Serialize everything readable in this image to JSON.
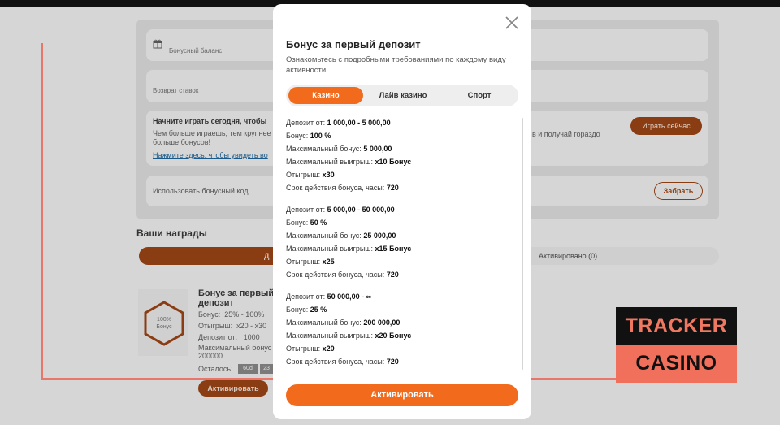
{
  "background": {
    "bonus_balance_label": "Бонусный баланс",
    "bet_refund_label": "Возврат ставок",
    "play_today_title": "Начните играть сегодня, чтобы",
    "play_today_text": "Чем больше играешь, тем крупнее больше бонусов!",
    "play_today_link": "Нажмите здесь, чтобы увидеть во",
    "play_today_right_text": "в и получай гораздо",
    "play_now_button": "Играть сейчас",
    "promo_code_label": "Использовать бонусный код",
    "take_button": "Забрать",
    "rewards_title": "Ваши награды",
    "tab_available": "Д",
    "tab_activated": "Активировано (0)",
    "reward": {
      "badge_line1": "100%",
      "badge_line2": "Бонус",
      "title": "Бонус за первый депозит",
      "bonus_label": "Бонус:",
      "bonus_value": "25% - 100%",
      "wager_label": "Отыгрыш:",
      "wager_value": "x20 - x30",
      "deposit_label": "Депозит от:",
      "deposit_value": "1000",
      "max_bonus_label": "Максимальный бонус",
      "max_bonus_value": "200000",
      "remaining_label": "Осталось:",
      "tag1": "60d",
      "tag2": "23",
      "activate_button": "Активировать"
    }
  },
  "watermark": {
    "line1": "TRACKER",
    "line2": "CASINO"
  },
  "modal": {
    "title": "Бонус за первый депозит",
    "subtitle": "Ознакомьтесь с подробными требованиями по каждому виду активности.",
    "tabs": [
      {
        "label": "Казино",
        "active": true
      },
      {
        "label": "Лайв казино",
        "active": false
      },
      {
        "label": "Спорт",
        "active": false
      }
    ],
    "tiers": [
      {
        "deposit_label": "Депозит от:",
        "deposit_value": "1 000,00   - 5 000,00",
        "bonus_label": "Бонус:",
        "bonus_value": "100 %",
        "max_bonus_label": "Максимальный бонус:",
        "max_bonus_value": "5 000,00",
        "max_win_label": "Максимальный выигрыш:",
        "max_win_value": "x10 Бонус",
        "wager_label": "Отыгрыш:",
        "wager_value": "x30",
        "validity_label": "Срок действия бонуса, часы:",
        "validity_value": "720"
      },
      {
        "deposit_label": "Депозит от:",
        "deposit_value": "5 000,00   - 50 000,00",
        "bonus_label": "Бонус:",
        "bonus_value": "50 %",
        "max_bonus_label": "Максимальный бонус:",
        "max_bonus_value": "25 000,00",
        "max_win_label": "Максимальный выигрыш:",
        "max_win_value": "x15 Бонус",
        "wager_label": "Отыгрыш:",
        "wager_value": "x25",
        "validity_label": "Срок действия бонуса, часы:",
        "validity_value": "720"
      },
      {
        "deposit_label": "Депозит от:",
        "deposit_value": "50 000,00   - ∞",
        "bonus_label": "Бонус:",
        "bonus_value": "25 %",
        "max_bonus_label": "Максимальный бонус:",
        "max_bonus_value": "200 000,00",
        "max_win_label": "Максимальный выигрыш:",
        "max_win_value": "x20 Бонус",
        "wager_label": "Отыгрыш:",
        "wager_value": "x20",
        "validity_label": "Срок действия бонуса, часы:",
        "validity_value": "720"
      }
    ],
    "activate_button": "Активировать"
  }
}
